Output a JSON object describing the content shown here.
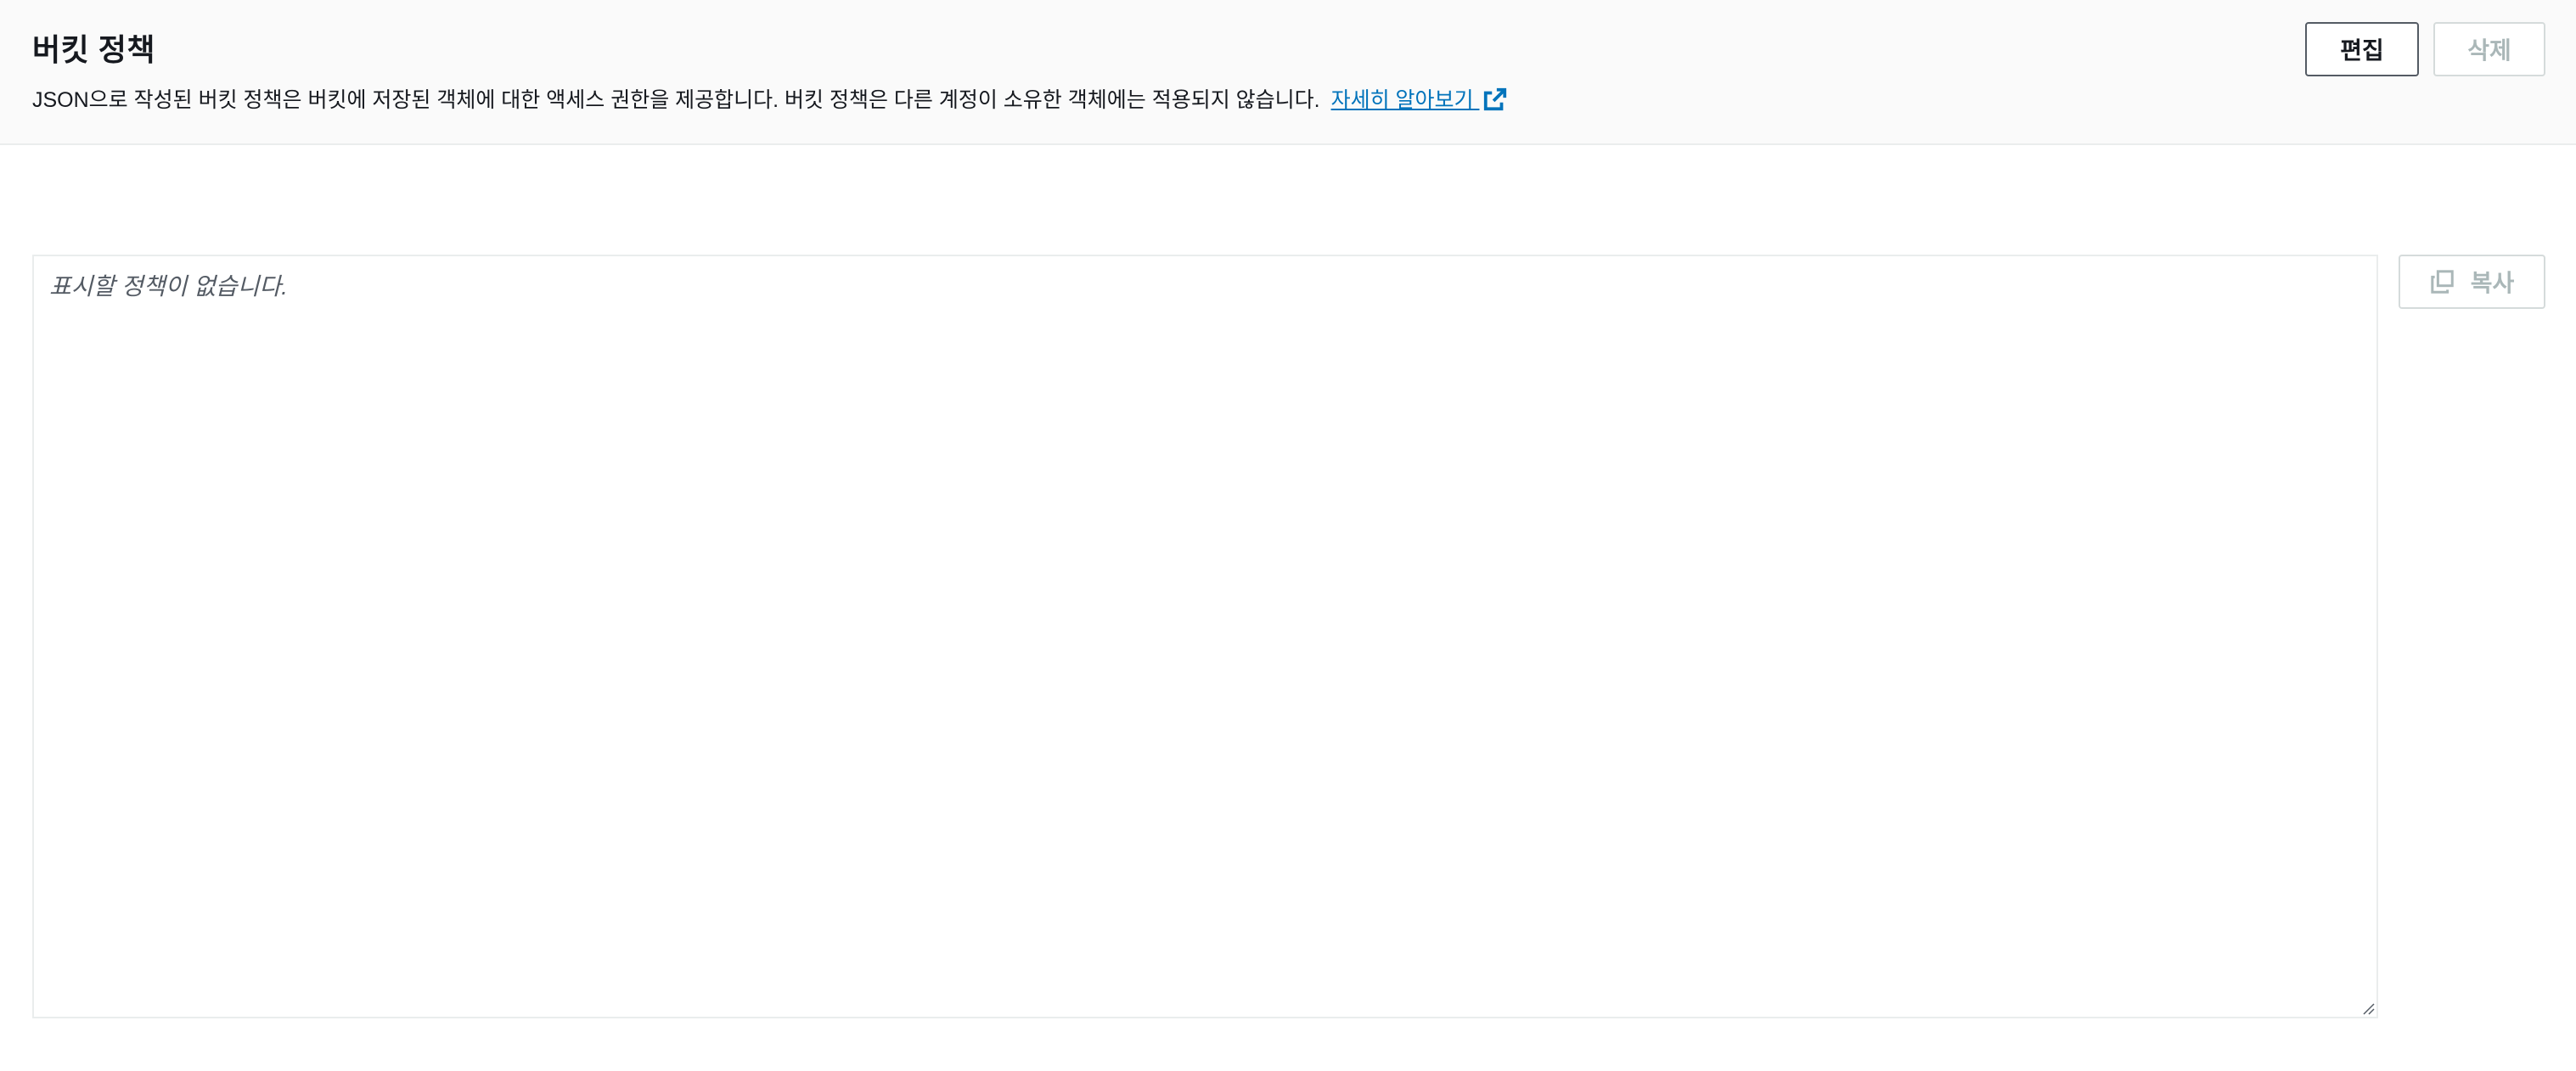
{
  "header": {
    "title": "버킷 정책",
    "description": "JSON으로 작성된 버킷 정책은 버킷에 저장된 객체에 대한 액세스 권한을 제공합니다. 버킷 정책은 다른 계정이 소유한 객체에는 적용되지 않습니다.",
    "learn_more": "자세히 알아보기",
    "learn_more_icon": "external-link-icon"
  },
  "actions": {
    "edit_label": "편집",
    "delete_label": "삭제"
  },
  "policy_editor": {
    "placeholder": "표시할 정책이 없습니다.",
    "copy_label": "복사",
    "copy_icon": "copy-icon"
  },
  "colors": {
    "link": "#0073bb",
    "disabled": "#aab7b8",
    "header_bg": "#fafafa"
  }
}
